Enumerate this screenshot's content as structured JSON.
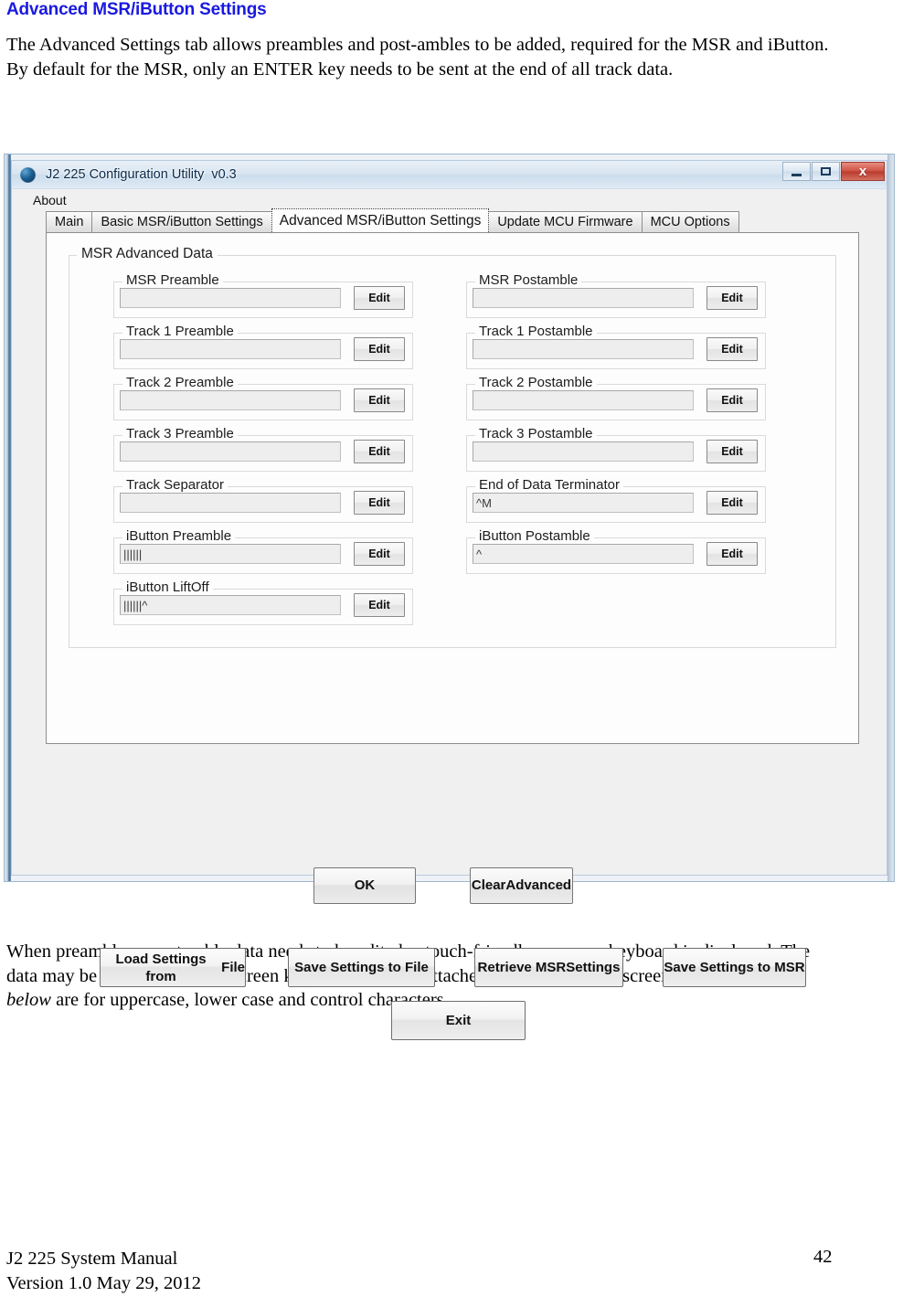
{
  "document": {
    "heading": "Advanced MSR/iButton Settings",
    "intro_paragraph": "The Advanced Settings tab allows preambles and post-ambles to be added, required for the MSR and iButton. By default for the MSR, only an ENTER key needs to be sent at the end of all track data.",
    "after_paragraph_part1": "When preamble or postamble data needs to be edited, a touch-friendly onscreen keyboard is displayed. The data may be entered by the onscreen keyboard or by an attached keyboard. The onscreen keyboards ",
    "after_paragraph_italic": "shown below",
    "after_paragraph_part2": " are for uppercase, lower case and control characters.",
    "footer_line1": "J2 225 System Manual",
    "footer_line2": "Version 1.0 May 29, 2012",
    "page_number": "42",
    "heading_color": "#1a19e0"
  },
  "window": {
    "title": "J2 225 Configuration Utility  v0.3",
    "icon": "app-globe-icon",
    "controls": {
      "minimize": "minimize-icon",
      "maximize": "maximize-icon",
      "close": "x"
    }
  },
  "menubar": {
    "items": [
      {
        "label": "About"
      }
    ]
  },
  "tabs": [
    {
      "label": "Main",
      "active": false
    },
    {
      "label": "Basic MSR/iButton Settings",
      "active": false
    },
    {
      "label": "Advanced MSR/iButton Settings",
      "active": true
    },
    {
      "label": "Update MCU Firmware",
      "active": false
    },
    {
      "label": "MCU Options",
      "active": false
    }
  ],
  "groupbox": {
    "title": "MSR Advanced Data"
  },
  "fields_left": [
    {
      "label": "MSR Preamble",
      "value": "",
      "edit_label": "Edit"
    },
    {
      "label": "Track 1 Preamble",
      "value": "",
      "edit_label": "Edit"
    },
    {
      "label": "Track 2 Preamble",
      "value": "",
      "edit_label": "Edit"
    },
    {
      "label": "Track 3 Preamble",
      "value": "",
      "edit_label": "Edit"
    },
    {
      "label": "Track Separator",
      "value": "",
      "edit_label": "Edit"
    },
    {
      "label": "iButton Preamble",
      "value": "||||||",
      "edit_label": "Edit"
    },
    {
      "label": "iButton LiftOff",
      "value": "||||||^",
      "edit_label": "Edit"
    }
  ],
  "fields_right": [
    {
      "label": "MSR Postamble",
      "value": "",
      "edit_label": "Edit"
    },
    {
      "label": "Track 1 Postamble",
      "value": "",
      "edit_label": "Edit"
    },
    {
      "label": "Track 2 Postamble",
      "value": "",
      "edit_label": "Edit"
    },
    {
      "label": "Track 3 Postamble",
      "value": "",
      "edit_label": "Edit"
    },
    {
      "label": "End of Data Terminator",
      "value": "^M",
      "edit_label": "Edit"
    },
    {
      "label": "iButton Postamble",
      "value": "^",
      "edit_label": "Edit"
    }
  ],
  "inner_buttons": {
    "ok": "OK",
    "clear_advanced_line1": "Clear",
    "clear_advanced_line2": "Advanced"
  },
  "action_buttons": {
    "load_settings_line1": "Load Settings from",
    "load_settings_line2": "File",
    "save_settings_to_file": "Save Settings to File",
    "retrieve_msr_line1": "Retrieve MSR",
    "retrieve_msr_line2": "Settings",
    "save_settings_to_msr": "Save Settings to MSR",
    "exit": "Exit"
  }
}
